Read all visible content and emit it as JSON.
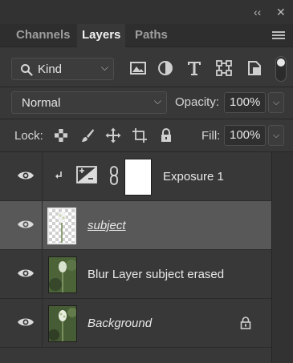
{
  "titlebar": {
    "collapse_glyph": "‹‹",
    "close_glyph": "✕"
  },
  "tabs": [
    {
      "label": "Channels",
      "active": false
    },
    {
      "label": "Layers",
      "active": true
    },
    {
      "label": "Paths",
      "active": false
    }
  ],
  "filter": {
    "kind_label": "Kind",
    "icons": [
      "image-filter-icon",
      "adjustment-filter-icon",
      "type-filter-icon",
      "shape-filter-icon",
      "smart-object-filter-icon"
    ],
    "toggle_on": true
  },
  "blend": {
    "mode": "Normal",
    "opacity_label": "Opacity:",
    "opacity": "100%"
  },
  "lock": {
    "label": "Lock:",
    "fill_label": "Fill:",
    "fill": "100%"
  },
  "layers": [
    {
      "name": "Exposure 1",
      "type": "adjustment",
      "visible": true,
      "clipped": true,
      "selected": false
    },
    {
      "name": "subject",
      "type": "pixel-transparent",
      "visible": true,
      "selected": true
    },
    {
      "name": "Blur Layer subject erased",
      "type": "pixel-photo",
      "visible": true,
      "selected": false
    },
    {
      "name": "Background",
      "type": "background",
      "visible": true,
      "selected": false,
      "locked": true
    }
  ],
  "colors": {
    "panel": "#383838",
    "selected_row": "#585858",
    "text": "#e8e8e8"
  }
}
